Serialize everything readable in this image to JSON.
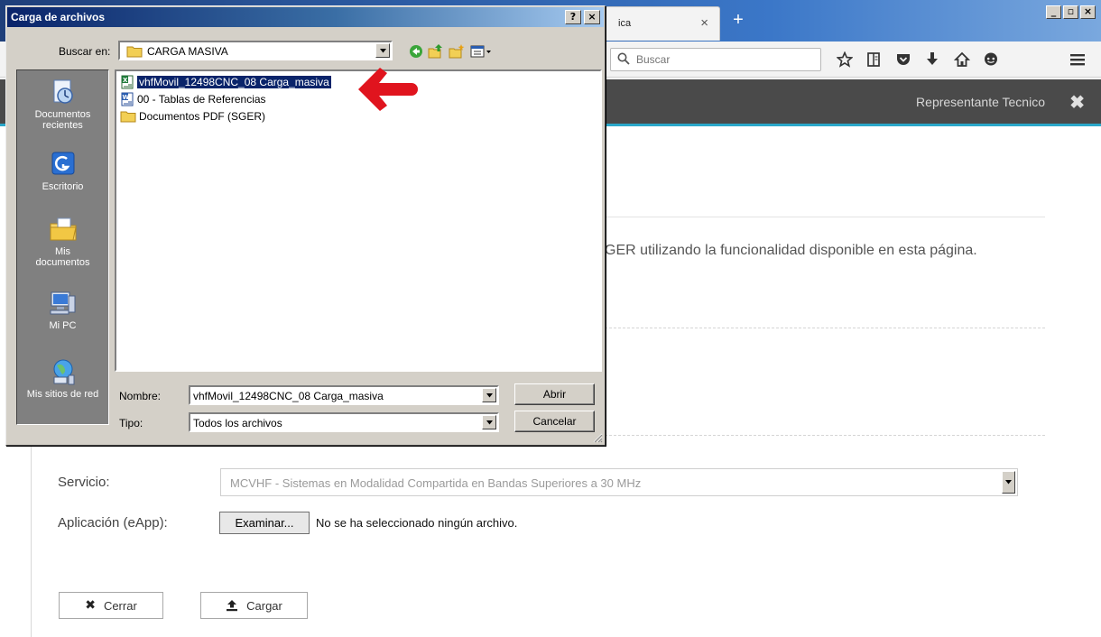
{
  "browser": {
    "tab_label": "ica",
    "tab_close": "×",
    "new_tab": "+",
    "search_placeholder": "Buscar",
    "win_min": "_",
    "win_max": "▫",
    "win_close": "×"
  },
  "header": {
    "user_label": "Representante Tecnico",
    "close_glyph": "✖"
  },
  "page": {
    "intro_text": "GER utilizando la funcionalidad disponible en esta página.",
    "service_label": "Servicio:",
    "service_value": "MCVHF - Sistemas en Modalidad Compartida en Bandas Superiores a 30 MHz",
    "app_label": "Aplicación (eApp):",
    "browse_label": "Examinar...",
    "no_file_text": "No se ha seleccionado ningún archivo.",
    "close_label": "Cerrar",
    "upload_label": "Cargar"
  },
  "dialog": {
    "title": "Carga de archivos",
    "help_glyph": "?",
    "close_glyph": "×",
    "look_in_label": "Buscar en:",
    "look_in_value": "CARGA MASIVA",
    "places": [
      {
        "label_line1": "Documentos",
        "label_line2": "recientes"
      },
      {
        "label_line1": "Escritorio",
        "label_line2": ""
      },
      {
        "label_line1": "Mis",
        "label_line2": "documentos"
      },
      {
        "label_line1": "Mi PC",
        "label_line2": ""
      },
      {
        "label_line1": "Mis sitios de red",
        "label_line2": ""
      }
    ],
    "files": [
      {
        "name": "vhfMovil_12498CNC_08 Carga_masiva",
        "type": "excel",
        "selected": true
      },
      {
        "name": "00 - Tablas de Referencias",
        "type": "word",
        "selected": false
      },
      {
        "name": "Documentos PDF (SGER)",
        "type": "folder",
        "selected": false
      }
    ],
    "name_label": "Nombre:",
    "name_value": "vhfMovil_12498CNC_08 Carga_masiva",
    "type_label": "Tipo:",
    "type_value": "Todos los archivos",
    "open_label": "Abrir",
    "cancel_label": "Cancelar"
  },
  "colors": {
    "accent_cyan": "#2aa7c9",
    "header_bg": "#4a4a4a",
    "selection_blue": "#0a246a",
    "annotation_red": "#e0141e"
  }
}
